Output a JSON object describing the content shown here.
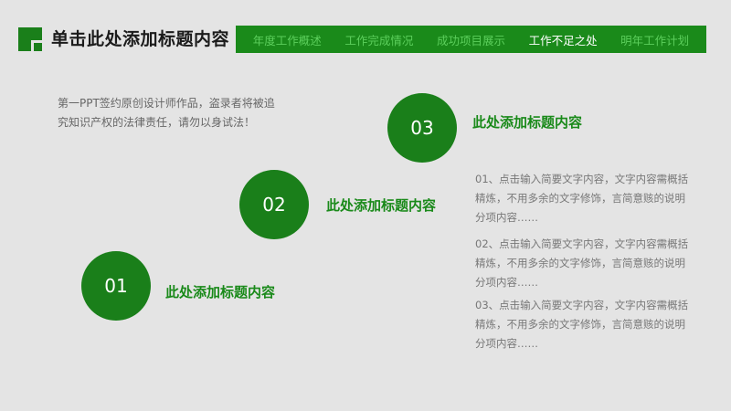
{
  "header": {
    "title": "单击此处添加标题内容",
    "logo_icon": "green-square-logo-icon"
  },
  "nav": {
    "items": [
      {
        "label": "年度工作概述",
        "active": false
      },
      {
        "label": "工作完成情况",
        "active": false
      },
      {
        "label": "成功项目展示",
        "active": false
      },
      {
        "label": "工作不足之处",
        "active": true
      },
      {
        "label": "明年工作计划",
        "active": false
      }
    ]
  },
  "intro": {
    "text": "第一PPT签约原创设计师作品，盗录者将被追究知识产权的法律责任，请勿以身试法！"
  },
  "steps": [
    {
      "number": "01",
      "title": "此处添加标题内容"
    },
    {
      "number": "02",
      "title": "此处添加标题内容"
    },
    {
      "number": "03",
      "title": "此处添加标题内容"
    }
  ],
  "descriptions": [
    "01、点击输入简要文字内容，文字内容需概括精炼，不用多余的文字修饰，言简意赅的说明分项内容……",
    "02、点击输入简要文字内容，文字内容需概括精炼，不用多余的文字修饰，言简意赅的说明分项内容……",
    "03、点击输入简要文字内容，文字内容需概括精炼，不用多余的文字修饰，言简意赅的说明分项内容……"
  ],
  "colors": {
    "accent": "#1a7f1a",
    "nav_bg": "#1a8a1a",
    "background": "#e4e4e4"
  }
}
